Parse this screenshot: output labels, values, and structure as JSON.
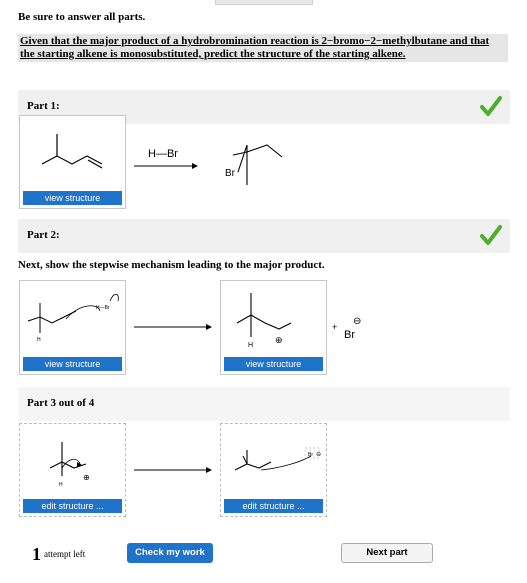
{
  "intro": "Be sure to answer all parts.",
  "question": "Given that the major product of a hydrobromination reaction is 2−bromo−2−methylbutane and that the starting alkene is monosubstituted, predict the structure of the starting alkene.",
  "part1": {
    "label": "Part 1:",
    "view_button": "view structure",
    "reagent": "H—Br",
    "product_atom": "Br",
    "status_icon": "checkmark-icon"
  },
  "part2": {
    "label": "Part 2:",
    "instruction": "Next, show the stepwise mechanism leading to the major product.",
    "left_view_button": "view structure",
    "right_view_button": "view structure",
    "left_labels": {
      "h": "H",
      "hbr": "H—Br"
    },
    "right_labels": {
      "h": "H",
      "charge": "⊕"
    },
    "plus": "+",
    "bromide": "Br",
    "anion_charge": "⊖",
    "status_icon": "checkmark-icon"
  },
  "part3": {
    "label": "Part 3 out of 4",
    "left_edit_button": "edit structure ...",
    "right_edit_button": "edit structure ...",
    "left_labels": {
      "h": "H",
      "charge": "⊕"
    },
    "right_labels": {
      "br": "Br",
      "charge": "⊖"
    }
  },
  "footer": {
    "attempts_count": "1",
    "attempts_label": "attempt left",
    "check_button": "Check my work",
    "next_button": "Next part"
  },
  "colors": {
    "accent": "#1f73c9",
    "success": "#4caf2a"
  }
}
